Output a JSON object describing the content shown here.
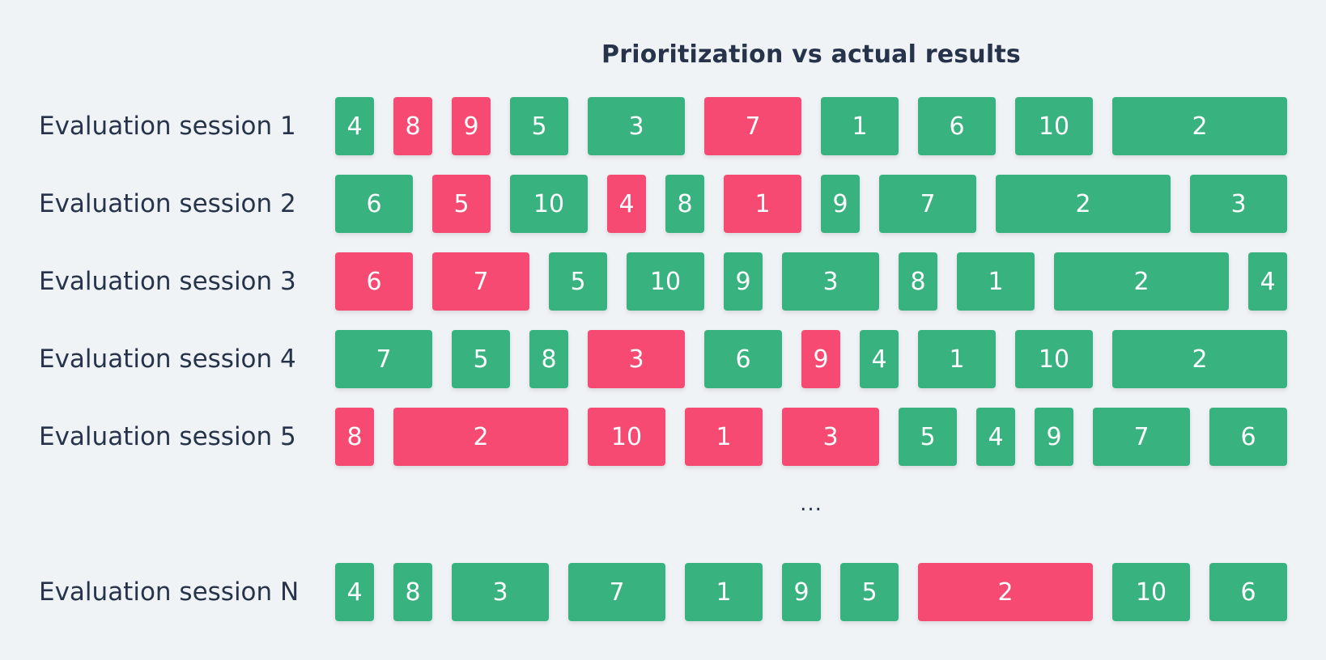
{
  "title": "Prioritization vs actual results",
  "ellipsis": "...",
  "colors": {
    "success": "#38b27f",
    "failure": "#f74a72",
    "background": "#f0f3f6",
    "text": "#26334a"
  },
  "sessions": [
    {
      "label": "Evaluation session 1",
      "items": [
        {
          "value": "4",
          "status": "success",
          "relative_size": 1
        },
        {
          "value": "8",
          "status": "failure",
          "relative_size": 1
        },
        {
          "value": "9",
          "status": "failure",
          "relative_size": 1
        },
        {
          "value": "5",
          "status": "success",
          "relative_size": 1.5
        },
        {
          "value": "3",
          "status": "success",
          "relative_size": 2.5
        },
        {
          "value": "7",
          "status": "failure",
          "relative_size": 2.5
        },
        {
          "value": "1",
          "status": "success",
          "relative_size": 2
        },
        {
          "value": "6",
          "status": "success",
          "relative_size": 2
        },
        {
          "value": "10",
          "status": "success",
          "relative_size": 2
        },
        {
          "value": "2",
          "status": "success",
          "relative_size": 4.5
        }
      ]
    },
    {
      "label": "Evaluation session 2",
      "items": [
        {
          "value": "6",
          "status": "success",
          "relative_size": 2
        },
        {
          "value": "5",
          "status": "failure",
          "relative_size": 1.5
        },
        {
          "value": "10",
          "status": "success",
          "relative_size": 2
        },
        {
          "value": "4",
          "status": "failure",
          "relative_size": 1
        },
        {
          "value": "8",
          "status": "success",
          "relative_size": 1
        },
        {
          "value": "1",
          "status": "failure",
          "relative_size": 2
        },
        {
          "value": "9",
          "status": "success",
          "relative_size": 1
        },
        {
          "value": "7",
          "status": "success",
          "relative_size": 2.5
        },
        {
          "value": "2",
          "status": "success",
          "relative_size": 4.5
        },
        {
          "value": "3",
          "status": "success",
          "relative_size": 2.5
        }
      ]
    },
    {
      "label": "Evaluation session 3",
      "items": [
        {
          "value": "6",
          "status": "failure",
          "relative_size": 2
        },
        {
          "value": "7",
          "status": "failure",
          "relative_size": 2.5
        },
        {
          "value": "5",
          "status": "success",
          "relative_size": 1.5
        },
        {
          "value": "10",
          "status": "success",
          "relative_size": 2
        },
        {
          "value": "9",
          "status": "success",
          "relative_size": 1
        },
        {
          "value": "3",
          "status": "success",
          "relative_size": 2.5
        },
        {
          "value": "8",
          "status": "success",
          "relative_size": 1
        },
        {
          "value": "1",
          "status": "success",
          "relative_size": 2
        },
        {
          "value": "2",
          "status": "success",
          "relative_size": 4.5
        },
        {
          "value": "4",
          "status": "success",
          "relative_size": 1
        }
      ]
    },
    {
      "label": "Evaluation session 4",
      "items": [
        {
          "value": "7",
          "status": "success",
          "relative_size": 2.5
        },
        {
          "value": "5",
          "status": "success",
          "relative_size": 1.5
        },
        {
          "value": "8",
          "status": "success",
          "relative_size": 1
        },
        {
          "value": "3",
          "status": "failure",
          "relative_size": 2.5
        },
        {
          "value": "6",
          "status": "success",
          "relative_size": 2
        },
        {
          "value": "9",
          "status": "failure",
          "relative_size": 1
        },
        {
          "value": "4",
          "status": "success",
          "relative_size": 1
        },
        {
          "value": "1",
          "status": "success",
          "relative_size": 2
        },
        {
          "value": "10",
          "status": "success",
          "relative_size": 2
        },
        {
          "value": "2",
          "status": "success",
          "relative_size": 4.5
        }
      ]
    },
    {
      "label": "Evaluation session 5",
      "items": [
        {
          "value": "8",
          "status": "failure",
          "relative_size": 1
        },
        {
          "value": "2",
          "status": "failure",
          "relative_size": 4.5
        },
        {
          "value": "10",
          "status": "failure",
          "relative_size": 2
        },
        {
          "value": "1",
          "status": "failure",
          "relative_size": 2
        },
        {
          "value": "3",
          "status": "failure",
          "relative_size": 2.5
        },
        {
          "value": "5",
          "status": "success",
          "relative_size": 1.5
        },
        {
          "value": "4",
          "status": "success",
          "relative_size": 1
        },
        {
          "value": "9",
          "status": "success",
          "relative_size": 1
        },
        {
          "value": "7",
          "status": "success",
          "relative_size": 2.5
        },
        {
          "value": "6",
          "status": "success",
          "relative_size": 2
        }
      ]
    },
    {
      "label": "Evaluation session N",
      "items": [
        {
          "value": "4",
          "status": "success",
          "relative_size": 1
        },
        {
          "value": "8",
          "status": "success",
          "relative_size": 1
        },
        {
          "value": "3",
          "status": "success",
          "relative_size": 2.5
        },
        {
          "value": "7",
          "status": "success",
          "relative_size": 2.5
        },
        {
          "value": "1",
          "status": "success",
          "relative_size": 2
        },
        {
          "value": "9",
          "status": "success",
          "relative_size": 1
        },
        {
          "value": "5",
          "status": "success",
          "relative_size": 1.5
        },
        {
          "value": "2",
          "status": "failure",
          "relative_size": 4.5
        },
        {
          "value": "10",
          "status": "success",
          "relative_size": 2
        },
        {
          "value": "6",
          "status": "success",
          "relative_size": 2
        }
      ]
    }
  ]
}
